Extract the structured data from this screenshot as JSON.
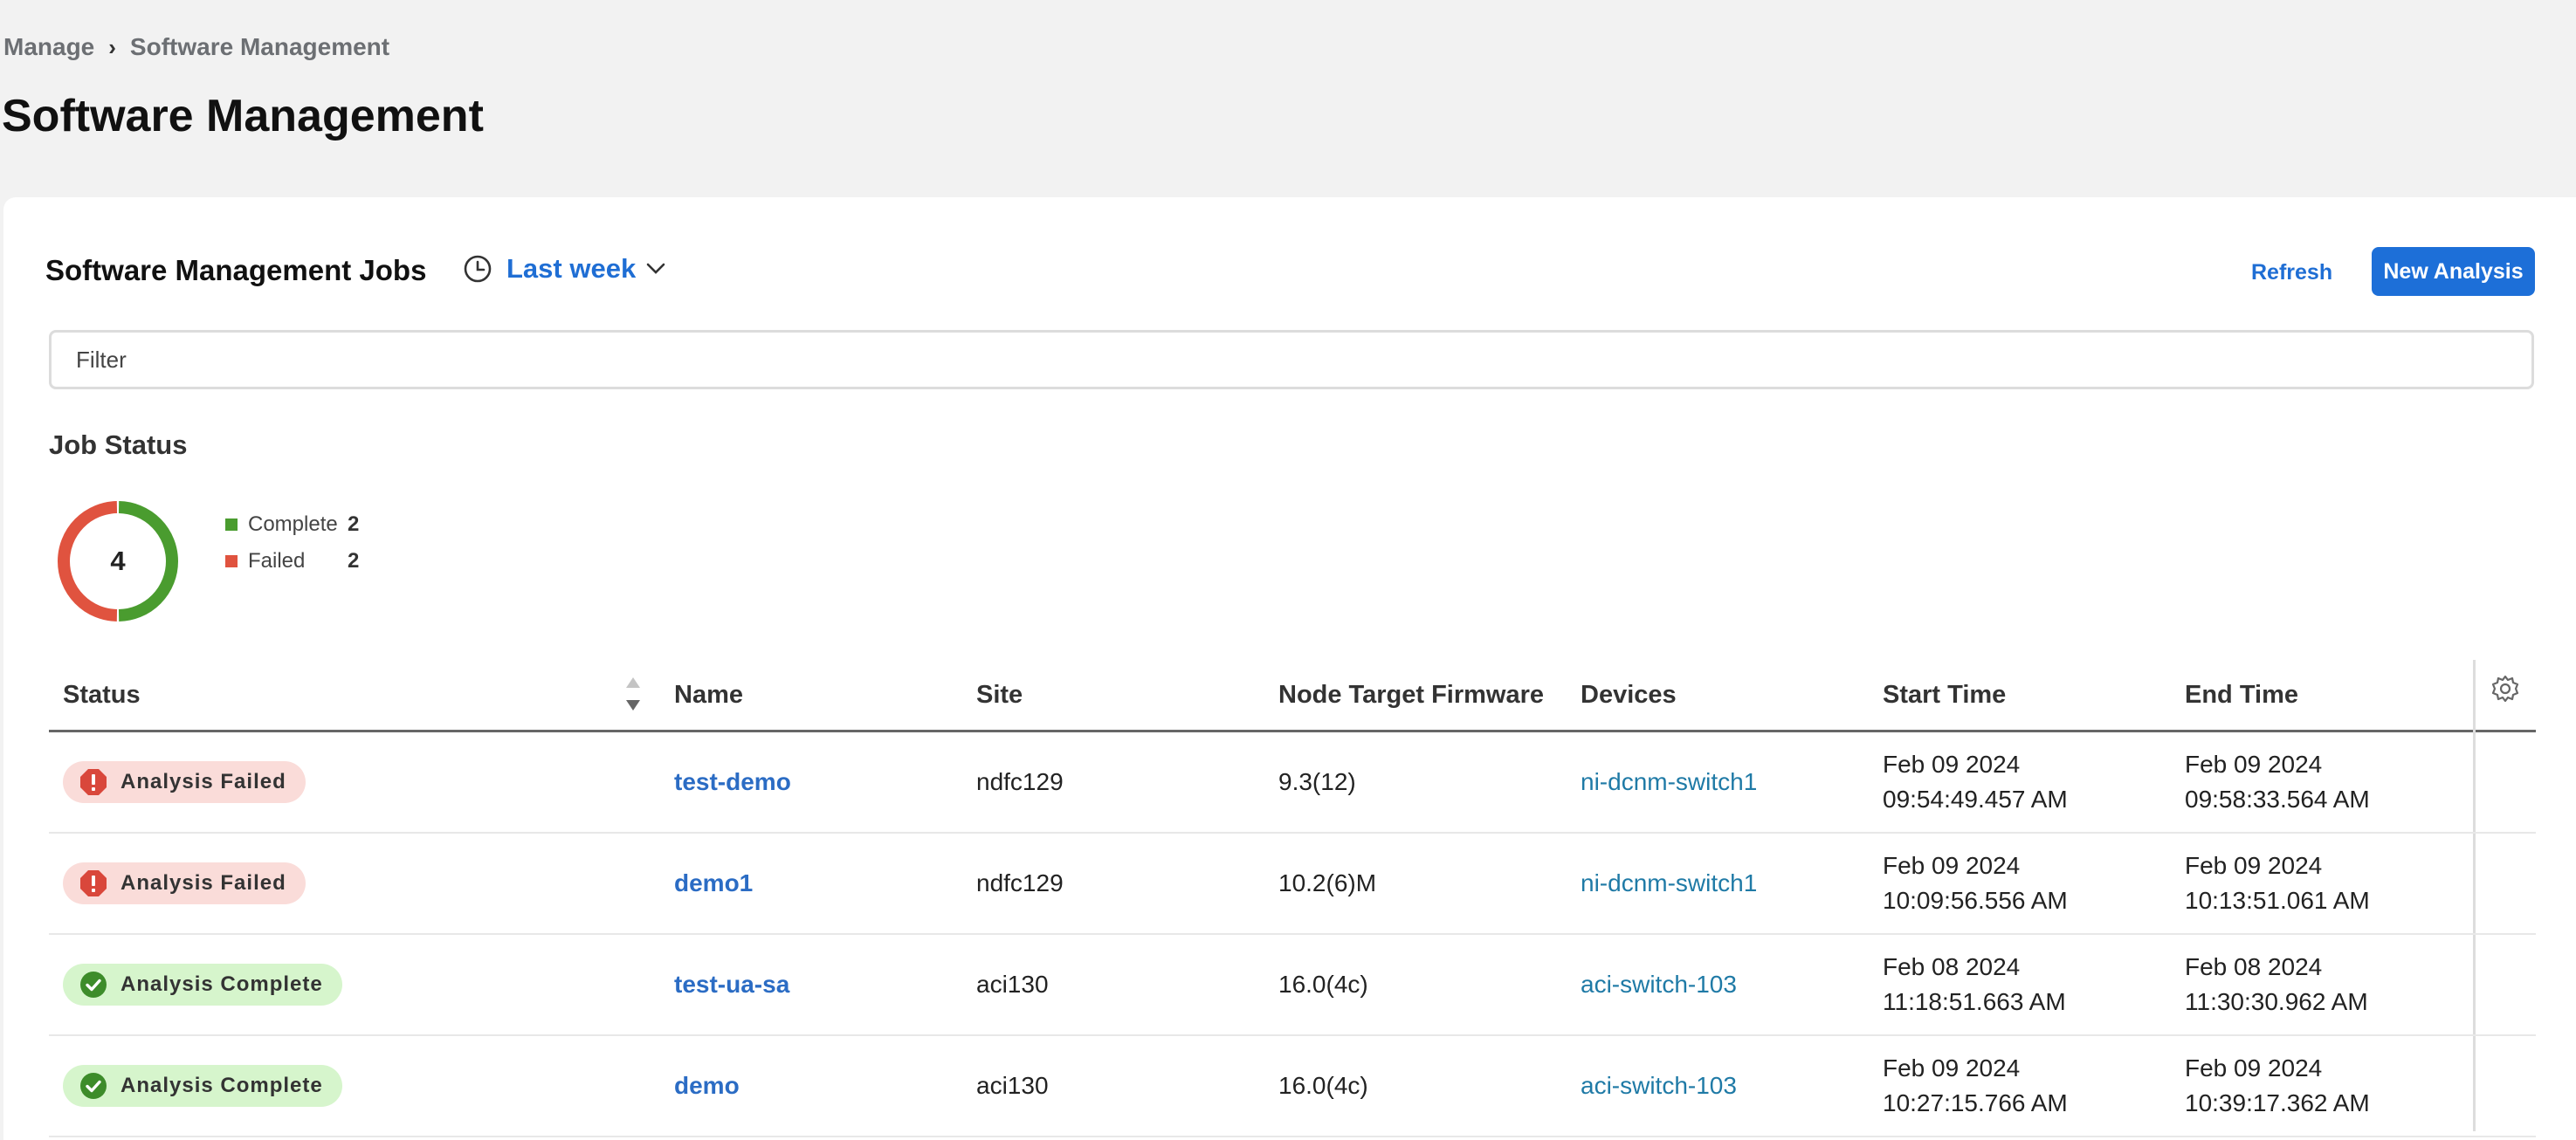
{
  "breadcrumb": {
    "parent": "Manage",
    "separator": "›",
    "current": "Software Management"
  },
  "page_title": "Software Management",
  "jobs": {
    "title": "Software Management Jobs",
    "time_range": "Last week",
    "refresh_label": "Refresh",
    "new_label": "New Analysis"
  },
  "filter": {
    "placeholder": "Filter",
    "value": ""
  },
  "job_status": {
    "heading": "Job Status",
    "total": "4",
    "legend": [
      {
        "label": "Complete",
        "count": "2",
        "color": "#4a9c2f"
      },
      {
        "label": "Failed",
        "count": "2",
        "color": "#e0533f"
      }
    ]
  },
  "chart_data": {
    "type": "pie",
    "categories": [
      "Complete",
      "Failed"
    ],
    "values": [
      2,
      2
    ],
    "colors": [
      "#4a9c2f",
      "#e0533f"
    ],
    "center_label": "4"
  },
  "table": {
    "columns": {
      "status": "Status",
      "name": "Name",
      "site": "Site",
      "firmware": "Node Target Firmware",
      "devices": "Devices",
      "start": "Start Time",
      "end": "End Time"
    },
    "rows": [
      {
        "status": "Analysis Failed",
        "status_type": "failed",
        "name": "test-demo",
        "site": "ndfc129",
        "firmware": "9.3(12)",
        "device": "ni-dcnm-switch1",
        "start_date": "Feb 09 2024",
        "start_time": "09:54:49.457 AM",
        "end_date": "Feb 09 2024",
        "end_time": "09:58:33.564 AM"
      },
      {
        "status": "Analysis Failed",
        "status_type": "failed",
        "name": "demo1",
        "site": "ndfc129",
        "firmware": "10.2(6)M",
        "device": "ni-dcnm-switch1",
        "start_date": "Feb 09 2024",
        "start_time": "10:09:56.556 AM",
        "end_date": "Feb 09 2024",
        "end_time": "10:13:51.061 AM"
      },
      {
        "status": "Analysis Complete",
        "status_type": "complete",
        "name": "test-ua-sa",
        "site": "aci130",
        "firmware": "16.0(4c)",
        "device": "aci-switch-103",
        "start_date": "Feb 08 2024",
        "start_time": "11:18:51.663 AM",
        "end_date": "Feb 08 2024",
        "end_time": "11:30:30.962 AM"
      },
      {
        "status": "Analysis Complete",
        "status_type": "complete",
        "name": "demo",
        "site": "aci130",
        "firmware": "16.0(4c)",
        "device": "aci-switch-103",
        "start_date": "Feb 09 2024",
        "start_time": "10:27:15.766 AM",
        "end_date": "Feb 09 2024",
        "end_time": "10:39:17.362 AM"
      }
    ]
  },
  "icons": {
    "clock": "clock-icon",
    "chevron": "chevron-down-icon",
    "sort": "sort-icon",
    "gear": "gear-icon",
    "failed": "error-octagon-icon",
    "complete": "check-circle-icon"
  }
}
